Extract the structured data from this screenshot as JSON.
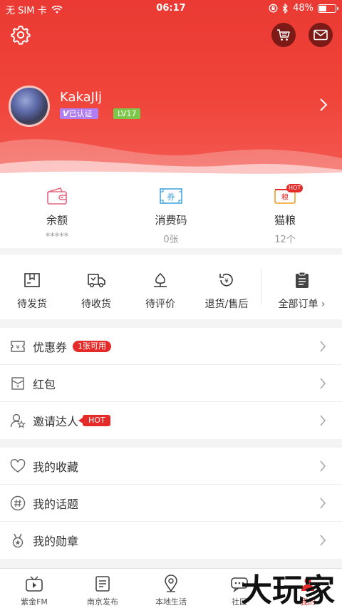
{
  "status_bar": {
    "carrier": "无 SIM 卡",
    "time": "06:17",
    "battery": "48%",
    "battery_level": 0.48
  },
  "header": {
    "icons": {
      "settings": "gear-icon",
      "cart": "cart-icon",
      "mail": "mail-icon"
    },
    "username": "KakaJlj",
    "verified_badge": "已认证",
    "level_badge": "LV17"
  },
  "wallet": [
    {
      "label": "余额",
      "value": "*****",
      "icon": "wallet-icon"
    },
    {
      "label": "消费码",
      "value": "0张",
      "icon": "ticket-icon"
    },
    {
      "label": "猫粮",
      "value": "12个",
      "icon": "cat-food-icon",
      "hot": "HOT",
      "icon_text": "粮"
    }
  ],
  "ticket_icon_text": "券",
  "orders": [
    {
      "label": "待发货",
      "icon": "box-icon"
    },
    {
      "label": "待收货",
      "icon": "truck-icon"
    },
    {
      "label": "待评价",
      "icon": "rate-icon"
    },
    {
      "label": "退货/售后",
      "icon": "refund-icon"
    },
    {
      "label": "全部订单",
      "icon": "clipboard-icon"
    }
  ],
  "list_group_1": [
    {
      "label": "优惠券",
      "tag": "1张可用",
      "icon": "coupon-icon"
    },
    {
      "label": "红包",
      "icon": "red-packet-icon"
    },
    {
      "label": "邀请达人",
      "tag": "HOT",
      "icon": "invite-icon"
    }
  ],
  "list_group_2": [
    {
      "label": "我的收藏",
      "icon": "heart-icon"
    },
    {
      "label": "我的话题",
      "icon": "hashtag-icon"
    },
    {
      "label": "我的勋章",
      "icon": "medal-icon"
    }
  ],
  "tabbar": [
    {
      "label": "紫金FM",
      "icon": "tv-icon"
    },
    {
      "label": "南京发布",
      "icon": "news-icon"
    },
    {
      "label": "本地生活",
      "icon": "location-icon"
    },
    {
      "label": "社区",
      "icon": "chat-icon"
    },
    {
      "label": "我的",
      "icon": "profile-icon",
      "active": true
    }
  ],
  "watermark": "大玩家",
  "colors": {
    "brand_red": "#e52a2a",
    "header_red": "#ea3a33",
    "verified_purple": "#b27ff2",
    "level_green": "#7cc74a"
  }
}
